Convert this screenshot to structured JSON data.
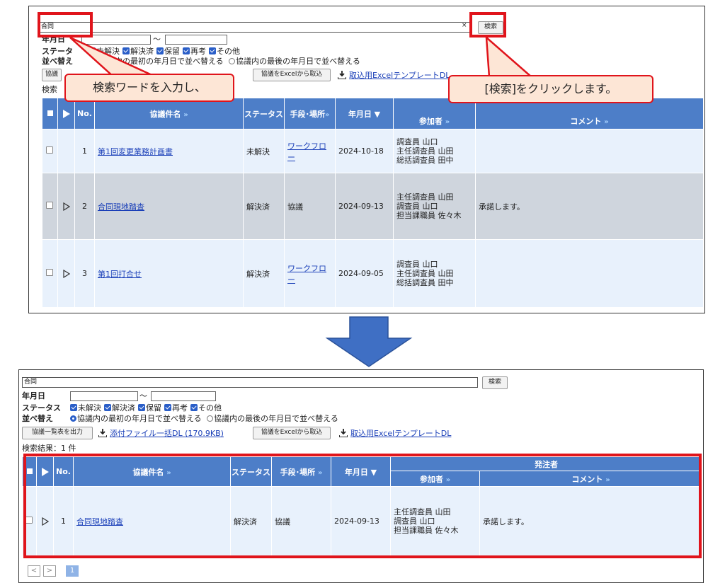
{
  "top": {
    "search_value": "合同",
    "search_button": "検索",
    "date_label": "年月日",
    "tilde": "～",
    "status_label_visible": "ステータ",
    "sort_label": "並べ替え",
    "status_items": [
      "未解決",
      "解決済",
      "保留",
      "再考",
      "その他"
    ],
    "sort_fragment": "議内の最初の年月日で並べ替える",
    "sort_option_2": "協議内の最後の年月日で並べ替える",
    "btn_partial": "協議",
    "excel_import": "協議をExcelから取込",
    "template_dl": "取込用Excelテンプレート",
    "template_dl_suffix": "DL",
    "result_partial": "検索",
    "headers": {
      "no": "No.",
      "title": "協議件名",
      "status": "ステータス",
      "means": "手段･場所",
      "date": "年月日 ▼",
      "participants": "参加者",
      "comment": "コメント"
    },
    "rows": [
      {
        "no": "1",
        "title": "第1回変更業務計画書",
        "status": "未解決",
        "means": "ワークフロー",
        "means_link": true,
        "date": "2024-10-18",
        "people": [
          "調査員 山口",
          "主任調査員 山田",
          "総括調査員 田中"
        ],
        "comment": "",
        "expand": false
      },
      {
        "no": "2",
        "title": "合同現地踏査",
        "status": "解決済",
        "means": "協議",
        "means_link": false,
        "date": "2024-09-13",
        "people": [
          "主任調査員 山田",
          "調査員 山口",
          "担当課職員 佐々木"
        ],
        "comment": "承諾します。",
        "expand": true
      },
      {
        "no": "3",
        "title": "第1回打合せ",
        "status": "解決済",
        "means": "ワークフロー",
        "means_link": true,
        "date": "2024-09-05",
        "people": [
          "調査員 山口",
          "主任調査員 山田",
          "総括調査員 田中"
        ],
        "comment": "",
        "expand": true
      }
    ],
    "callout_left": "検索ワードを入力し、",
    "callout_right": "[検索]をクリックします。"
  },
  "bottom": {
    "search_value": "合同",
    "search_button": "検索",
    "date_label": "年月日",
    "tilde": "～",
    "status_label": "ステータス",
    "sort_label": "並べ替え",
    "status_items": [
      "未解決",
      "解決済",
      "保留",
      "再考",
      "その他"
    ],
    "sort_option_1": "協議内の最初の年月日で並べ替える",
    "sort_option_2": "協議内の最後の年月日で並べ替える",
    "export_list": "協議一覧表を出力",
    "attach_dl": "添付ファイル一括DL (170.9KB)",
    "excel_import": "協議をExcelから取込",
    "template_dl": "取込用ExcelテンプレートDL",
    "result_count": "検索結果：1 件",
    "headers": {
      "no": "No.",
      "title": "協議件名",
      "status": "ステータス",
      "means": "手段･場所",
      "date": "年月日 ▼",
      "group": "発注者",
      "participants": "参加者",
      "comment": "コメント"
    },
    "rows": [
      {
        "no": "1",
        "title": "合同現地踏査",
        "status": "解決済",
        "means": "協議",
        "date": "2024-09-13",
        "people": [
          "主任調査員 山田",
          "調査員 山口",
          "担当課職員 佐々木"
        ],
        "comment": "承諾します。"
      }
    ],
    "pager": {
      "prev": "<",
      "next": ">",
      "current": "1"
    }
  },
  "colors": {
    "header_blue": "#4d7ec8",
    "row_light": "#e8f1fc",
    "row_gray": "#cfd5dd",
    "highlight_red": "#e0141b",
    "arrow_blue": "#3f6fc4",
    "callout_fill": "#fde6d6"
  },
  "arrow_icon": "down-arrow-icon",
  "sort_arrow": "»"
}
